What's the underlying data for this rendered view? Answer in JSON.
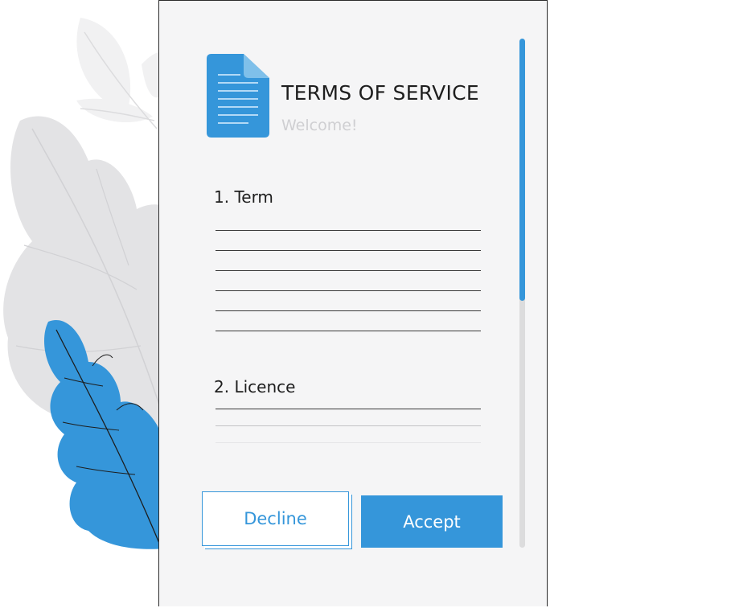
{
  "header": {
    "title": "TERMS OF SERVICE",
    "subtitle": "Welcome!"
  },
  "sections": [
    {
      "heading": "1. Term"
    },
    {
      "heading": "2. Licence"
    }
  ],
  "actions": {
    "decline_label": "Decline",
    "accept_label": "Accept"
  },
  "colors": {
    "accent": "#3596da",
    "leaf_gray": "#e3e3e5",
    "panel_bg": "#f5f5f6"
  },
  "icons": {
    "document": "document-icon"
  }
}
